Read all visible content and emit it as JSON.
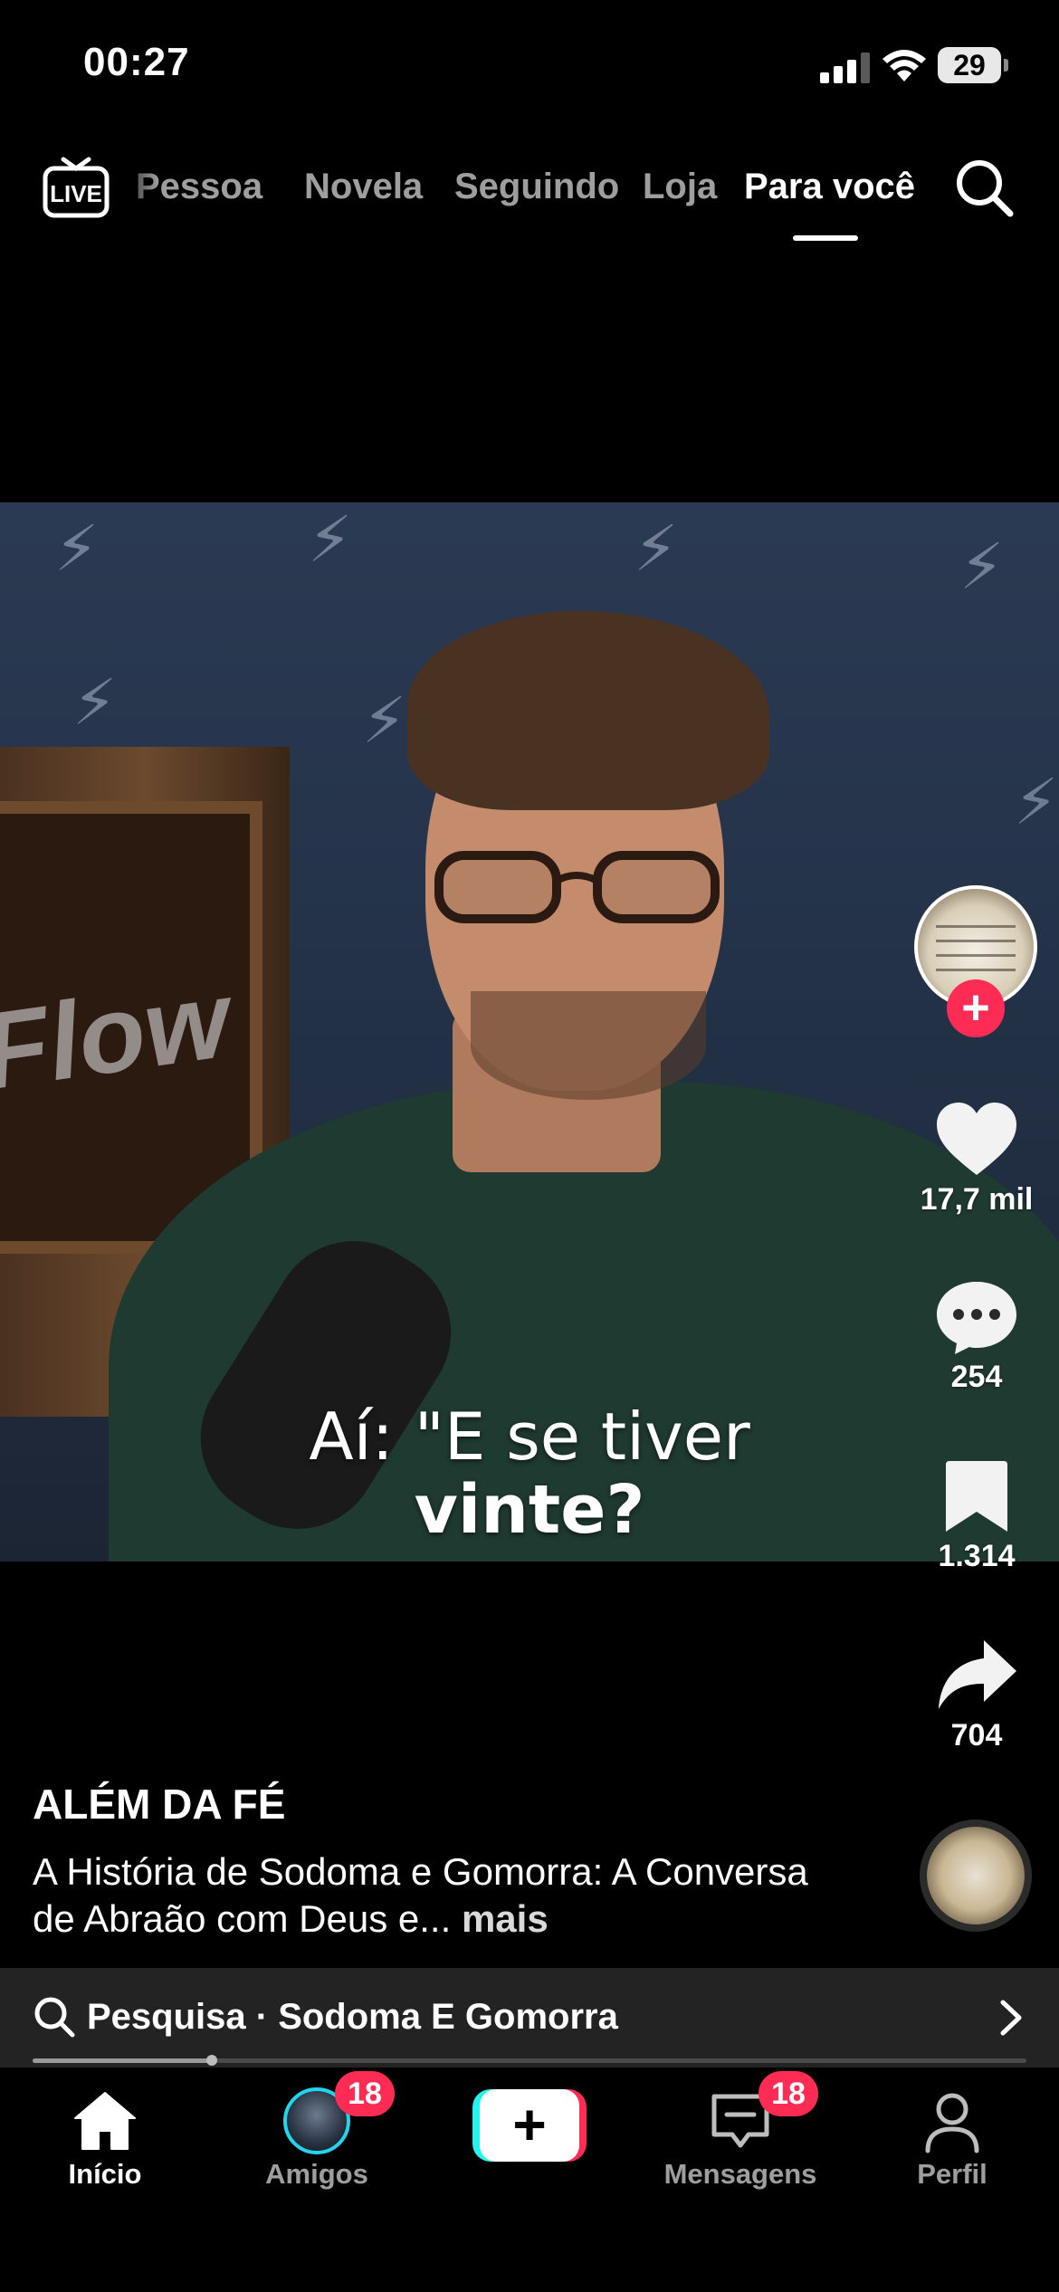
{
  "status_bar": {
    "time": "00:27",
    "battery_level": "29"
  },
  "top_nav": {
    "live_label": "LIVE",
    "tabs": [
      {
        "label": "Pessoa",
        "active": false
      },
      {
        "label": "Novela",
        "active": false
      },
      {
        "label": "Seguindo",
        "active": false
      },
      {
        "label": "Loja",
        "active": false
      },
      {
        "label": "Para você",
        "active": true
      }
    ],
    "search_icon": "search-icon"
  },
  "video": {
    "background_sign": "Flow",
    "subtitle_line1": "Aí: \"E se tiver",
    "subtitle_line2": "vinte?"
  },
  "side_actions": {
    "like_count": "17,7 mil",
    "comment_count": "254",
    "bookmark_count": "1.314",
    "share_count": "704"
  },
  "post": {
    "author": "ALÉM DA FÉ",
    "caption": "A História de Sodoma e Gomorra: A Conversa de Abraão com Deus e...",
    "more_label": "mais"
  },
  "search_suggestion": {
    "text": "Pesquisa · Sodoma E Gomorra"
  },
  "playback": {
    "progress": 0.18
  },
  "bottom_nav": {
    "home_label": "Início",
    "friends_label": "Amigos",
    "friends_badge": "18",
    "messages_label": "Mensagens",
    "messages_badge": "18",
    "profile_label": "Perfil"
  },
  "colors": {
    "accent": "#fe2c55",
    "cyan": "#25f4ee",
    "background": "#000000"
  }
}
